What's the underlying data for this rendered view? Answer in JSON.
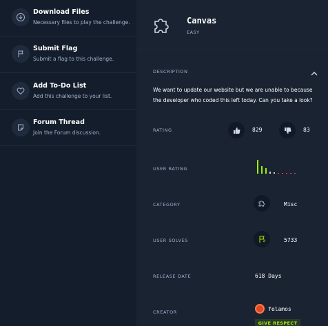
{
  "sidebar": {
    "items": [
      {
        "title": "Download Files",
        "subtitle": "Necessary files to play the challenge.",
        "icon": "download-icon"
      },
      {
        "title": "Submit Flag",
        "subtitle": "Submit a flag to this challenge.",
        "icon": "flag-icon"
      },
      {
        "title": "Add To-Do List",
        "subtitle": "Add this challenge to your list.",
        "icon": "heart-icon"
      },
      {
        "title": "Forum Thread",
        "subtitle": "Join the Forum discussion.",
        "icon": "forum-icon"
      }
    ]
  },
  "challenge": {
    "title": "Canvas",
    "difficulty": "EASY",
    "icon": "puzzle-icon"
  },
  "details": {
    "description_label": "DESCRIPTION",
    "description": "We want to update our website but we are unable to because the developer who coded this left today. Can you take a look?",
    "rating_label": "RATING",
    "likes": "829",
    "dislikes": "83",
    "user_rating_label": "USER RATING",
    "user_rating_distribution": [
      1.0,
      0.55,
      0.4,
      0.15,
      0.08,
      0.05,
      0.05,
      0.05,
      0.05,
      0.05
    ],
    "category_label": "CATEGORY",
    "category": "Misc",
    "user_solves_label": "USER SOLVES",
    "user_solves": "5733",
    "release_date_label": "RELEASE DATE",
    "release_date": "618 Days",
    "creator_label": "CREATOR",
    "creator": "felamos",
    "give_respect": "GIVE RESPECT"
  },
  "colors": {
    "accent": "#9fef00",
    "sidebar_bg": "#141d2b",
    "main_bg": "#1a2332",
    "muted_text": "#a4b1cd"
  }
}
